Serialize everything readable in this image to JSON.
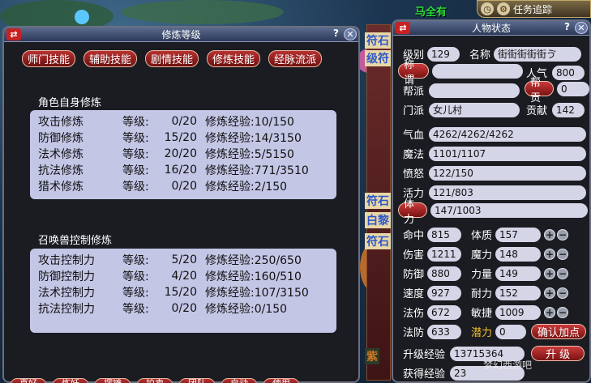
{
  "top": {
    "npc_name": "马全有",
    "track_label": "任务追踪"
  },
  "scenery_signs": [
    "符石",
    "级符",
    "符石",
    "白黎",
    "符石",
    "紫"
  ],
  "cultivation_window": {
    "title": "修炼等级",
    "help": "?",
    "close": "✕",
    "tabs": [
      "师门技能",
      "辅助技能",
      "剧情技能",
      "修炼技能",
      "经脉流派"
    ],
    "self_section": {
      "title": "角色自身修炼",
      "rows": [
        {
          "name": "攻击修炼",
          "level_label": "等级:",
          "level": "0/20",
          "exp": "修炼经验:10/150"
        },
        {
          "name": "防御修炼",
          "level_label": "等级:",
          "level": "15/20",
          "exp": "修炼经验:14/3150"
        },
        {
          "name": "法术修炼",
          "level_label": "等级:",
          "level": "20/20",
          "exp": "修炼经验:5/5150"
        },
        {
          "name": "抗法修炼",
          "level_label": "等级:",
          "level": "16/20",
          "exp": "修炼经验:771/3510"
        },
        {
          "name": "猎术修炼",
          "level_label": "等级:",
          "level": "0/20",
          "exp": "修炼经验:2/150"
        }
      ]
    },
    "pet_section": {
      "title": "召唤兽控制修炼",
      "rows": [
        {
          "name": "攻击控制力",
          "level_label": "等级:",
          "level": "5/20",
          "exp": "修炼经验:250/650"
        },
        {
          "name": "防御控制力",
          "level_label": "等级:",
          "level": "4/20",
          "exp": "修炼经验:160/510"
        },
        {
          "name": "法术控制力",
          "level_label": "等级:",
          "level": "15/20",
          "exp": "修炼经验:107/3150"
        },
        {
          "name": "抗法控制力",
          "level_label": "等级:",
          "level": "0/20",
          "exp": "修炼经验:0/150"
        }
      ]
    },
    "bottom_buttons": [
      "喜好",
      "炼妖",
      "摆摊",
      "拍卖",
      "团队",
      "启动",
      "使用"
    ]
  },
  "status_window": {
    "title": "人物状态",
    "help": "?",
    "close": "✕",
    "level_label": "级别",
    "level": "129",
    "name_label": "名称",
    "name": "街街街街街ゔ",
    "title_btn": "称谓",
    "title_val": "",
    "popularity_label": "人气",
    "popularity": "800",
    "faction_label": "帮派",
    "faction": "",
    "contribution_btn": "帮贡",
    "contribution": "0",
    "school_label": "门派",
    "school": "女儿村",
    "donation_label": "贡献",
    "donation": "142",
    "hp_label": "气血",
    "hp": "4262/4262/4262",
    "mp_label": "魔法",
    "mp": "1101/1107",
    "rage_label": "愤怒",
    "rage": "122/150",
    "vitality_label": "活力",
    "vitality": "121/803",
    "stamina_btn": "体力",
    "stamina": "147/1003",
    "stats": [
      {
        "label": "命中",
        "value": "815",
        "attr": "体质",
        "attr_value": "157"
      },
      {
        "label": "伤害",
        "value": "1211",
        "attr": "魔力",
        "attr_value": "148"
      },
      {
        "label": "防御",
        "value": "880",
        "attr": "力量",
        "attr_value": "149"
      },
      {
        "label": "速度",
        "value": "927",
        "attr": "耐力",
        "attr_value": "152"
      },
      {
        "label": "法伤",
        "value": "672",
        "attr": "敏捷",
        "attr_value": "1009"
      }
    ],
    "mdef_label": "法防",
    "mdef": "633",
    "potential_label": "潜力",
    "potential": "0",
    "confirm_btn": "确认加点",
    "upgrade_exp_label": "升级经验",
    "upgrade_exp": "13715364",
    "upgrade_btn": "升 级",
    "gained_exp_label": "获得经验",
    "gained_exp": "23"
  },
  "watermark": "梦幻西游吧"
}
